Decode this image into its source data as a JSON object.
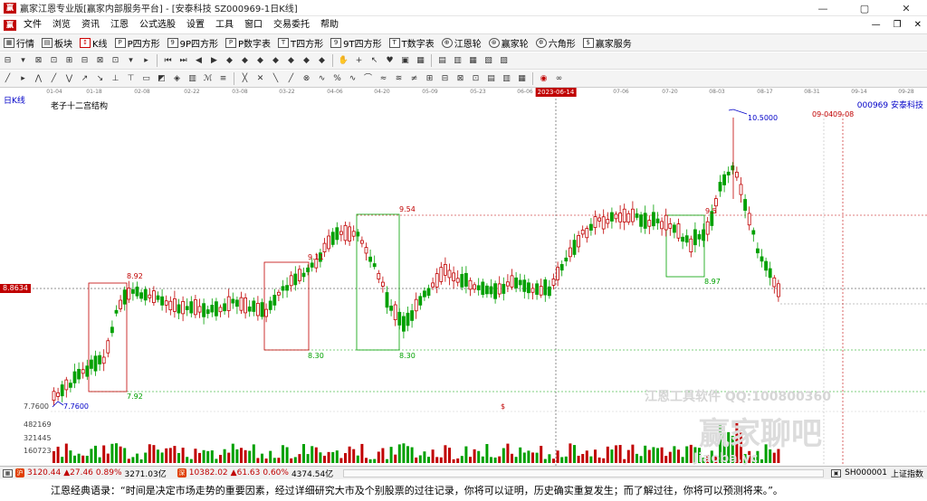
{
  "window": {
    "title": "赢家江恩专业版[赢家内部服务平台] - [安泰科技  SZ000969-1日K线]",
    "controls": [
      "—",
      "▢",
      "✕"
    ]
  },
  "menu": {
    "items": [
      "文件",
      "浏览",
      "资讯",
      "江恩",
      "公式选股",
      "设置",
      "工具",
      "窗口",
      "交易委托",
      "帮助"
    ],
    "right": [
      "—",
      "❐",
      "✕"
    ]
  },
  "toolbar_main": {
    "items": [
      {
        "label": "行情",
        "icon": "grid-icon"
      },
      {
        "label": "板块",
        "icon": "blocks-icon"
      },
      {
        "label": "K线",
        "icon": "candles-icon"
      },
      {
        "label": "P四方形",
        "icon": "p-square-icon"
      },
      {
        "label": "9P四方形",
        "icon": "9p-square-icon"
      },
      {
        "label": "P数字表",
        "icon": "p-table-icon"
      },
      {
        "label": "T四方形",
        "icon": "t-square-icon"
      },
      {
        "label": "9T四方形",
        "icon": "9t-square-icon"
      },
      {
        "label": "T数字表",
        "icon": "t-table-icon"
      },
      {
        "label": "江恩轮",
        "icon": "gann-wheel-icon"
      },
      {
        "label": "赢家轮",
        "icon": "winner-wheel-icon"
      },
      {
        "label": "六角形",
        "icon": "hexagon-icon"
      },
      {
        "label": "赢家服务",
        "icon": "service-icon"
      }
    ]
  },
  "chart": {
    "period_label": "日K线",
    "structure_label": "老子十二宫结构",
    "stock_ref": "000969  安泰科技",
    "current_price": "8.8634",
    "x_ticks": [
      "01-04",
      "01-18",
      "02-08",
      "02-22",
      "03-08",
      "03-22",
      "04-06",
      "04-20",
      "05-09",
      "05-23",
      "06-06",
      "07-06",
      "07-20",
      "08-03",
      "08-17",
      "08-31",
      "09-14",
      "09-28"
    ],
    "x_cursor": "2023-06-14",
    "y_min_label": "7.7600",
    "vol_labels": [
      "482169",
      "321445",
      "160723"
    ],
    "annotations": [
      "8.92",
      "7.92",
      "7.7600",
      "9.11",
      "8.30",
      "9.54",
      "8.30",
      "9.5",
      "8.97",
      "10.5000",
      "09-04",
      "09-08",
      "$"
    ],
    "watermark_line1": "江恩工具软件  QQ:100800360",
    "watermark_line2": "赢家聊吧",
    "watermark_line3": "Jiaoba.yc"
  },
  "status": {
    "sh_index": "3120.44",
    "sh_change": "▲27.46",
    "sh_pct": "0.89%",
    "sh_amount": "3271.03亿",
    "sz_index": "10382.02",
    "sz_change": "▲61.63",
    "sz_pct": "0.60%",
    "sz_amount": "4374.54亿",
    "right_code": "SH000001",
    "right_name": "上证指数"
  },
  "quote": "江恩经典语录：“时间是决定市场走势的重要因素，经过详细研究大市及个别股票的过往记录，你将可以证明，历史确实重复发生；而了解过往，你将可以预测将来。”。"
}
